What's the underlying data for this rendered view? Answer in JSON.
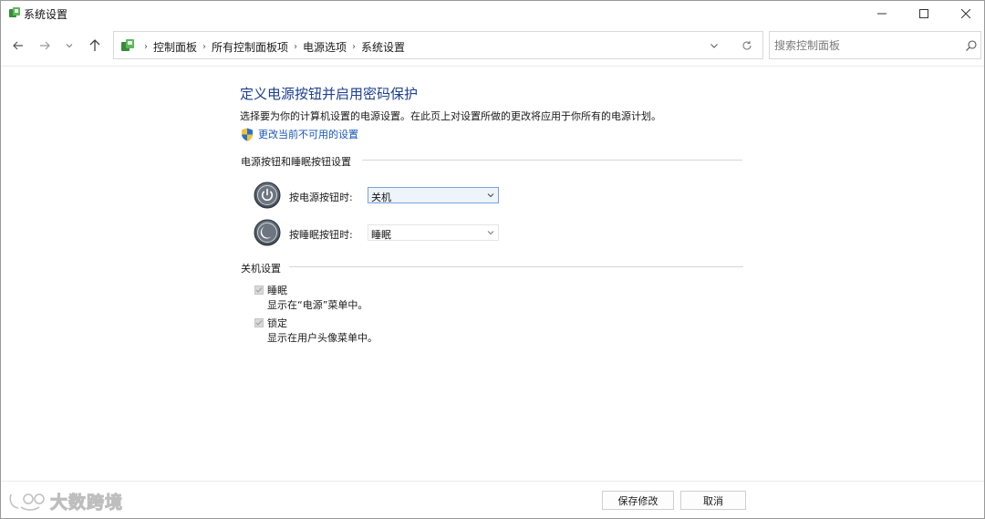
{
  "window": {
    "title": "系统设置"
  },
  "nav": {
    "breadcrumbs": [
      "控制面板",
      "所有控制面板项",
      "电源选项",
      "系统设置"
    ],
    "search_placeholder": "搜索控制面板"
  },
  "content": {
    "heading": "定义电源按钮并启用密码保护",
    "description": "选择要为你的计算机设置的电源设置。在此页上对设置所做的更改将应用于你所有的电源计划。",
    "change_link": "更改当前不可用的设置",
    "section_buttons": "电源按钮和睡眠按钮设置",
    "power_button_label": "按电源按钮时:",
    "power_button_value": "关机",
    "sleep_button_label": "按睡眠按钮时:",
    "sleep_button_value": "睡眠",
    "section_shutdown": "关机设置",
    "options": [
      {
        "label": "睡眠",
        "desc": "显示在“电源”菜单中。",
        "checked": true,
        "disabled": true
      },
      {
        "label": "锁定",
        "desc": "显示在用户头像菜单中。",
        "checked": true,
        "disabled": true
      }
    ]
  },
  "footer": {
    "save_label": "保存修改",
    "cancel_label": "取消"
  },
  "watermark": {
    "text": "大数跨境"
  },
  "colors": {
    "heading": "#1d3f8f",
    "link": "#1a56b8",
    "select_active_border": "#7aa3d6"
  }
}
